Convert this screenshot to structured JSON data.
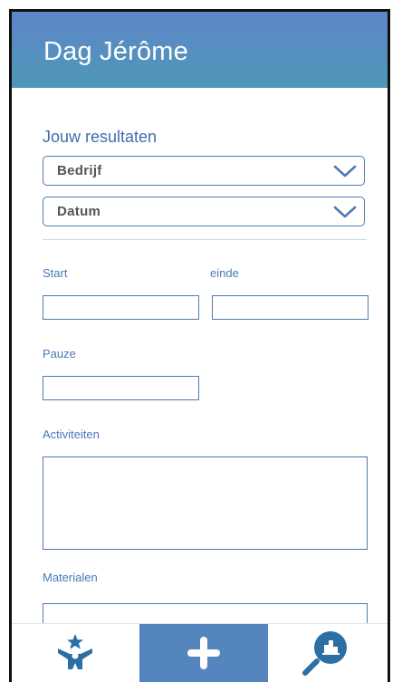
{
  "header": {
    "title": "Dag Jérôme"
  },
  "results": {
    "title": "Jouw resultaten"
  },
  "selects": {
    "company": "Bedrijf",
    "date": "Datum"
  },
  "form": {
    "start_label": "Start",
    "end_label": "einde",
    "pause_label": "Pauze",
    "activities_label": "Activiteiten",
    "materials_label": "Materialen"
  },
  "nav": {
    "items": [
      "achievements-icon",
      "plus-icon",
      "search-chart-icon"
    ],
    "active_color": "#5585bd"
  },
  "colors": {
    "header_top": "#5f86c7",
    "header_bottom": "#4d98b8",
    "accent": "#4f78b3"
  }
}
